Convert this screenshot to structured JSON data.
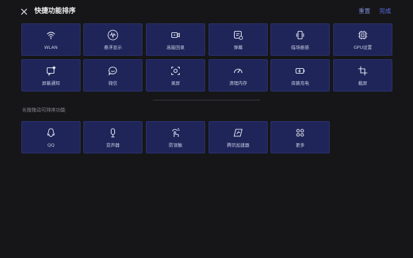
{
  "header": {
    "title": "快捷功能排序",
    "reset_label": "重置",
    "done_label": "完成"
  },
  "active": [
    {
      "label": "WLAN",
      "icon": "wifi-icon"
    },
    {
      "label": "悬浮显示",
      "icon": "waveform-icon"
    },
    {
      "label": "高能回录",
      "icon": "video-record-icon"
    },
    {
      "label": "弹幕",
      "icon": "bullet-chat-icon"
    },
    {
      "label": "临场振感",
      "icon": "vibration-icon"
    },
    {
      "label": "GPU设置",
      "icon": "chip-icon"
    },
    {
      "label": "屏蔽通知",
      "icon": "block-notification-icon"
    },
    {
      "label": "微信",
      "icon": "chat-bubble-icon"
    },
    {
      "label": "录屏",
      "icon": "screen-record-icon"
    },
    {
      "label": "清理内存",
      "icon": "gauge-icon"
    },
    {
      "label": "旁路充电",
      "icon": "battery-charge-icon"
    },
    {
      "label": "截屏",
      "icon": "crop-icon"
    }
  ],
  "section_label": "长按拖动可排序功能",
  "available": [
    {
      "label": "QQ",
      "icon": "penguin-icon"
    },
    {
      "label": "变声器",
      "icon": "microphone-icon"
    },
    {
      "label": "防误触",
      "icon": "touch-guard-icon"
    },
    {
      "label": "腾讯加速器",
      "icon": "accelerator-icon"
    },
    {
      "label": "更多",
      "icon": "grid-more-icon"
    }
  ],
  "colors": {
    "background": "#161618",
    "tile": "#1f2559",
    "accent": "#5b6df0"
  }
}
